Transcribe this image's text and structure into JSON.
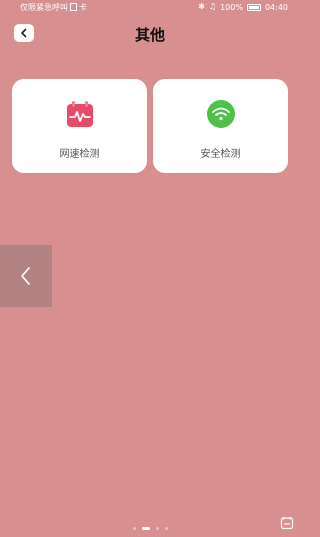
{
  "status_bar": {
    "carrier_text": "仅限紧急呼叫",
    "sim_text": "卡",
    "battery": "100%",
    "time": "04:40"
  },
  "header": {
    "title": "其他"
  },
  "cards": [
    {
      "label": "网速检测",
      "icon": "speed-test-icon"
    },
    {
      "label": "安全检测",
      "icon": "wifi-icon"
    }
  ],
  "pagination": {
    "count": 4,
    "active": 1
  },
  "colors": {
    "background": "#d88f90",
    "speed_icon": "#e84b68",
    "wifi_icon": "#4fc048"
  }
}
